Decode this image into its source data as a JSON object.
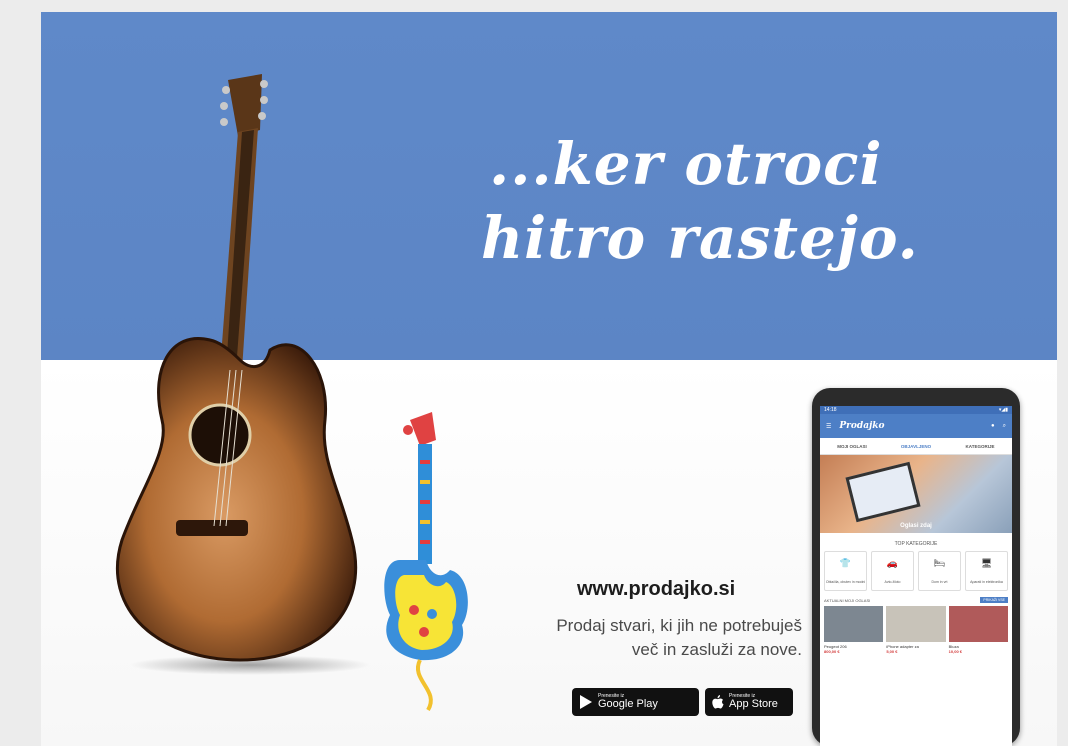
{
  "poster": {
    "slogan_line1": "...ker otroci",
    "slogan_line2": "hitro rastejo.",
    "url": "www.prodajko.si",
    "tagline_line1": "Prodaj stvari, ki jih ne potrebuješ",
    "tagline_line2": "več in zasluži za nove.",
    "colors": {
      "band": "#5f89c9",
      "background": "#ffffff"
    }
  },
  "badges": {
    "google_play": {
      "small": "Prenesite iz",
      "big": "Google Play"
    },
    "app_store": {
      "small": "Prenesite iz",
      "big": "App Store"
    }
  },
  "phone": {
    "status_time": "14:18",
    "app_name": "Prodajko",
    "tabs": [
      "MOJI OGLASI",
      "OBJAVLJENO",
      "KATEGORIJE"
    ],
    "banner_caption": "Oglasi zdaj",
    "top_categories_title": "TOP KATEGORIJE",
    "top_categories": [
      {
        "icon": "shirt-icon",
        "glyph": "👕",
        "label": "Oblačila, obutev in modni"
      },
      {
        "icon": "car-icon",
        "glyph": "🚗",
        "label": "Avto-Moto"
      },
      {
        "icon": "bed-icon",
        "glyph": "🛏",
        "label": "Dom in vrt"
      },
      {
        "icon": "monitor-icon",
        "glyph": "🖥",
        "label": "Aparati in elektronika"
      }
    ],
    "recent_title": "AKTUALNI MOJI OGLASI",
    "recent_button": "PRIKAŽI VSE",
    "listings": [
      {
        "title": "Peugeot 206",
        "price": "800,00 €",
        "color": "#7d8791"
      },
      {
        "title": "iPhone adapter za",
        "price": "5,00 €",
        "color": "#c8c3b9"
      },
      {
        "title": "Bluza",
        "price": "10,00 €",
        "color": "#b05a5a"
      }
    ]
  }
}
